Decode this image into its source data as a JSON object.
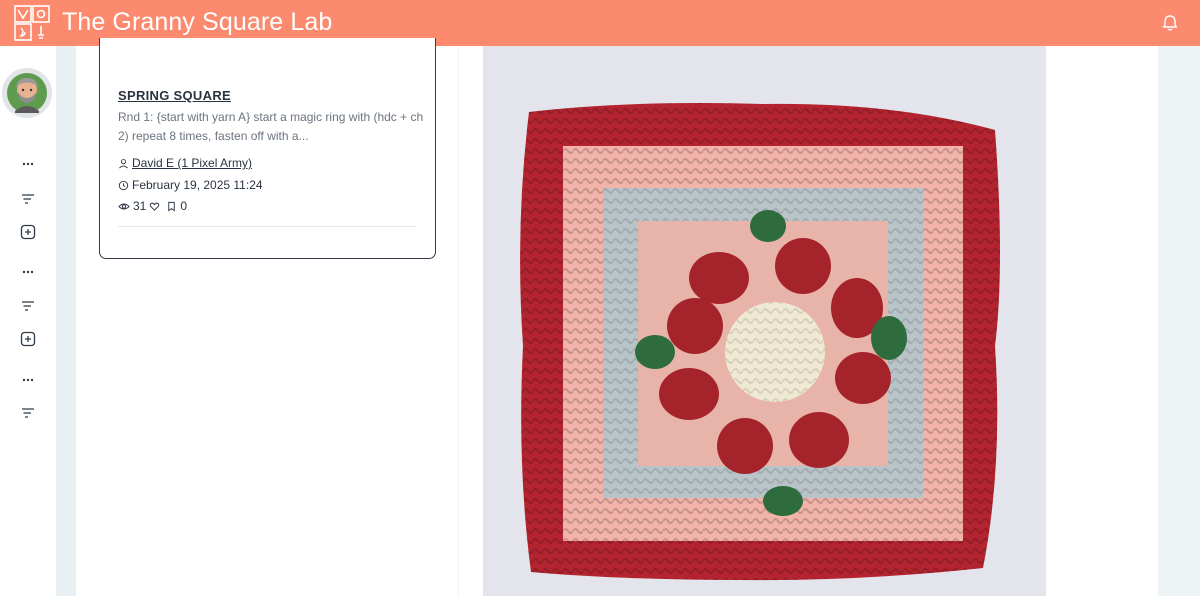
{
  "header": {
    "app_title": "The Granny Square Lab",
    "logo_icon": "granny-square-lab-logo",
    "notification_icon": "bell-icon",
    "color": "#fc8a6e"
  },
  "sidebar": {
    "avatar": "user-avatar",
    "buttons": [
      {
        "icon": "more-dots-icon"
      },
      {
        "icon": "sort-lines-icon"
      },
      {
        "icon": "add-square-icon"
      },
      {
        "icon": "more-dots-icon"
      },
      {
        "icon": "sort-lines-icon"
      },
      {
        "icon": "add-square-icon"
      },
      {
        "icon": "more-dots-icon"
      },
      {
        "icon": "sort-lines-icon"
      }
    ]
  },
  "post": {
    "title": "SPRING SQUARE",
    "description": "Rnd 1: {start with yarn A} start a magic ring with (hdc + ch 2) repeat 8 times, fasten off with a...",
    "author": "David E (1 Pixel Army)",
    "date": "February 19, 2025 11:24",
    "views": "31",
    "likes": "",
    "saves": "0"
  },
  "image": {
    "subject": "crochet granny square with red border and strawberry-red puff flower",
    "colors": {
      "border": "#b32430",
      "pink": "#f2b3aa",
      "grey_blue": "#b9c4c9",
      "red_petals": "#a5242b",
      "leaves": "#2e6b3d",
      "center": "#efe9d3"
    }
  }
}
